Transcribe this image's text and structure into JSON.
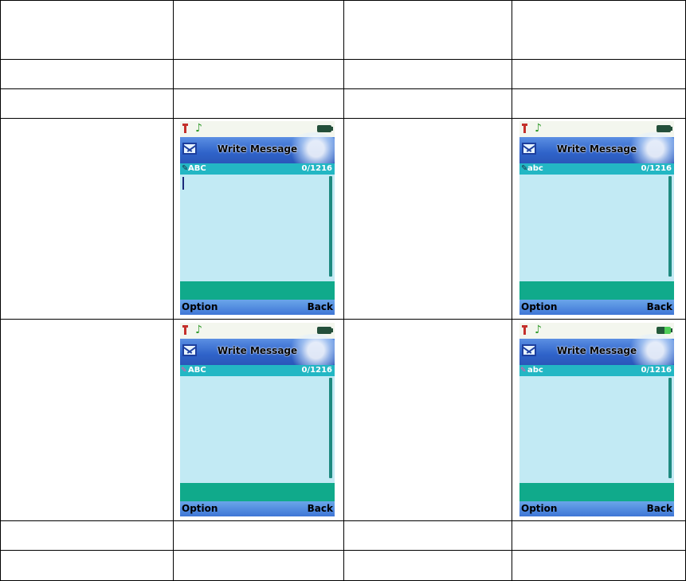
{
  "phones": [
    {
      "title": "Write Message",
      "input_mode": "ABC",
      "char_count": "0/1216",
      "left_softkey": "Option",
      "right_softkey": "Back",
      "show_cursor": true,
      "battery": "empty",
      "icons": [
        "signal-icon",
        "music-note-icon",
        "battery-icon",
        "envelope-icon",
        "pen-icon"
      ]
    },
    {
      "title": "Write Message",
      "input_mode": "abc",
      "char_count": "0/1216",
      "left_softkey": "Option",
      "right_softkey": "Back",
      "show_cursor": false,
      "battery": "empty",
      "icons": [
        "signal-icon",
        "music-note-icon",
        "battery-icon",
        "envelope-icon",
        "pen-icon"
      ]
    },
    {
      "title": "Write Message",
      "input_mode": "ABC",
      "char_count": "0/1216",
      "left_softkey": "Option",
      "right_softkey": "Back",
      "show_cursor": false,
      "battery": "empty",
      "icons": [
        "signal-icon",
        "music-note-icon",
        "battery-icon",
        "envelope-icon",
        "multitap-pen-icon"
      ]
    },
    {
      "title": "Write Message",
      "input_mode": "abc",
      "char_count": "0/1216",
      "left_softkey": "Option",
      "right_softkey": "Back",
      "show_cursor": false,
      "battery": "charging",
      "icons": [
        "signal-icon",
        "music-note-icon",
        "battery-icon",
        "envelope-icon",
        "multitap-pen-icon"
      ]
    }
  ],
  "colors": {
    "title_bar": "#2f63c9",
    "info_bar": "#23b7c4",
    "text_area": "#c2eaf4",
    "green_bar": "#10aa8b",
    "softkey_bar": "#3f76d6"
  }
}
